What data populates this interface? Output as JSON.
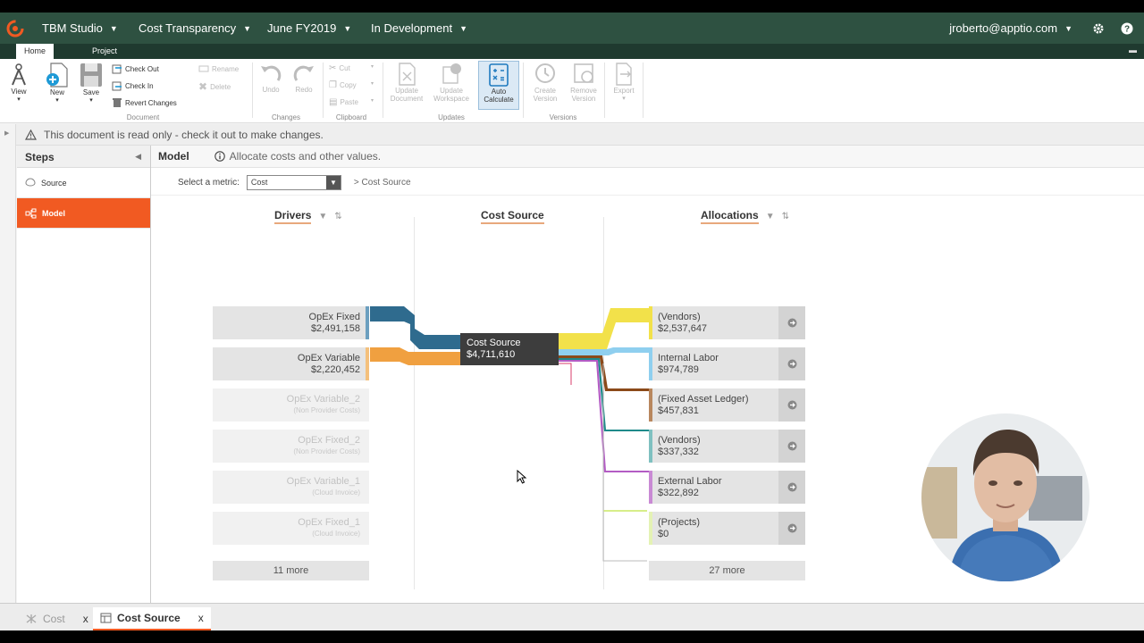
{
  "header": {
    "app": "TBM Studio",
    "model": "Cost Transparency",
    "period": "June FY2019",
    "state": "In Development",
    "user": "jroberto@apptio.com"
  },
  "ribbon_tabs": [
    "Home",
    "Project"
  ],
  "ribbon": {
    "view": "View",
    "new": "New",
    "save": "Save",
    "check_out": "Check Out",
    "check_in": "Check In",
    "revert": "Revert Changes",
    "rename": "Rename",
    "delete": "Delete",
    "document_group": "Document",
    "undo": "Undo",
    "redo": "Redo",
    "changes_group": "Changes",
    "cut": "Cut",
    "copy": "Copy",
    "paste": "Paste",
    "clipboard_group": "Clipboard",
    "update_document": [
      "Update",
      "Document"
    ],
    "update_workspace": [
      "Update",
      "Workspace"
    ],
    "auto_calculate": [
      "Auto",
      "Calculate"
    ],
    "updates_group": "Updates",
    "create_version": [
      "Create",
      "Version"
    ],
    "remove_version": [
      "Remove",
      "Version"
    ],
    "versions_group": "Versions",
    "export": "Export"
  },
  "message": "This document is read only - check it out to make changes.",
  "steps": {
    "title": "Steps",
    "items": [
      {
        "label": "Source"
      },
      {
        "label": "Model"
      }
    ]
  },
  "main": {
    "title": "Model",
    "info": "Allocate costs and other values.",
    "metric_label": "Select a metric:",
    "metric_value": "Cost",
    "breadcrumb": "> Cost Source"
  },
  "columns": {
    "drivers": "Drivers",
    "cost_source": "Cost Source",
    "allocations": "Allocations"
  },
  "drivers": [
    {
      "name": "OpEx Fixed",
      "value": "$2,491,158",
      "color": "#2f6b8e"
    },
    {
      "name": "OpEx Variable",
      "value": "$2,220,452",
      "color": "#f0a040"
    }
  ],
  "drivers_faded": [
    {
      "name": "OpEx Variable_2",
      "sub": "(Non Provider Costs)"
    },
    {
      "name": "OpEx Fixed_2",
      "sub": "(Non Provider Costs)"
    },
    {
      "name": "OpEx Variable_1",
      "sub": "(Cloud Invoice)"
    },
    {
      "name": "OpEx Fixed_1",
      "sub": "(Cloud Invoice)"
    }
  ],
  "drivers_more": "11 more",
  "cost_source": {
    "name": "Cost Source",
    "value": "$4,711,610"
  },
  "allocations": [
    {
      "name": "(Vendors)",
      "value": "$2,537,647",
      "color": "#f2e14a"
    },
    {
      "name": "Internal Labor",
      "value": "$974,789",
      "color": "#8fcfef"
    },
    {
      "name": "(Fixed Asset Ledger)",
      "value": "$457,831",
      "color": "#8b4a1a"
    },
    {
      "name": "(Vendors)",
      "value": "$337,332",
      "color": "#1e8a8a"
    },
    {
      "name": "External Labor",
      "value": "$322,892",
      "color": "#b35cc4"
    },
    {
      "name": "(Projects)",
      "value": "$0",
      "color": "#d7ee8a"
    }
  ],
  "allocations_more": "27 more",
  "bottom_tabs": [
    {
      "label": "Cost",
      "close": "x"
    },
    {
      "label": "Cost Source",
      "close": "x"
    }
  ]
}
